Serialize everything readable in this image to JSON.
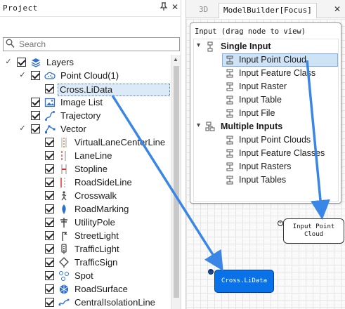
{
  "project_panel": {
    "title": "Project",
    "header_icons": [
      "pin-icon",
      "close-icon"
    ],
    "search": {
      "placeholder": "Search",
      "value": ""
    }
  },
  "tree": {
    "root": {
      "label": "Layers",
      "expanded": true,
      "checked": true
    },
    "point_cloud": {
      "label": "Point Cloud(1)",
      "expanded": true,
      "checked": true
    },
    "cross": {
      "label": "Cross.LiData",
      "checked": true,
      "selected": true
    },
    "image_list": {
      "label": "Image List",
      "checked": true
    },
    "trajectory": {
      "label": "Trajectory",
      "checked": true
    },
    "vector": {
      "label": "Vector",
      "expanded": true,
      "checked": true
    },
    "vector_items": [
      {
        "label": "VirtualLaneCenterLine",
        "icon": "dashed-line-icon",
        "checked": true
      },
      {
        "label": "LaneLine",
        "icon": "lane-line-icon",
        "checked": true
      },
      {
        "label": "Stopline",
        "icon": "stopline-icon",
        "checked": true
      },
      {
        "label": "RoadSideLine",
        "icon": "roadside-line-icon",
        "checked": true
      },
      {
        "label": "Crosswalk",
        "icon": "crosswalk-icon",
        "checked": true
      },
      {
        "label": "RoadMarking",
        "icon": "road-marking-icon",
        "checked": true
      },
      {
        "label": "UtilityPole",
        "icon": "utility-pole-icon",
        "checked": true
      },
      {
        "label": "StreetLight",
        "icon": "street-light-icon",
        "checked": true
      },
      {
        "label": "TrafficLight",
        "icon": "traffic-light-icon",
        "checked": true
      },
      {
        "label": "TrafficSign",
        "icon": "traffic-sign-icon",
        "checked": true
      },
      {
        "label": "Spot",
        "icon": "spot-icon",
        "checked": true
      },
      {
        "label": "RoadSurface",
        "icon": "road-surface-icon",
        "checked": true
      },
      {
        "label": "CentralIsolationLine",
        "icon": "isolation-line-icon",
        "checked": true
      }
    ]
  },
  "model_builder": {
    "tabs": [
      {
        "label": "3D",
        "active": false
      },
      {
        "label": "ModelBuilder[Focus]",
        "active": true
      }
    ],
    "palette": {
      "hint": "Input (drag node to view)",
      "groups": [
        {
          "label": "Single Input",
          "items": [
            "Input Point Cloud",
            "Input Feature Class",
            "Input Raster",
            "Input Table",
            "Input File"
          ],
          "selected": "Input Point Cloud"
        },
        {
          "label": "Multiple Inputs",
          "items": [
            "Input Point Clouds",
            "Input Feature Classes",
            "Input Rasters",
            "Input Tables"
          ]
        }
      ]
    },
    "nodes": {
      "input_point_cloud": "Input Point\nCloud",
      "cross": "Cross.LiData"
    },
    "ports": {
      "port_1": "+",
      "port_2": "+"
    }
  },
  "colors": {
    "arrow": "#3a86e6",
    "node_fill": "#0a72e8",
    "selection": "#cfe3f7",
    "accent_icon": "#2f6fd1"
  }
}
